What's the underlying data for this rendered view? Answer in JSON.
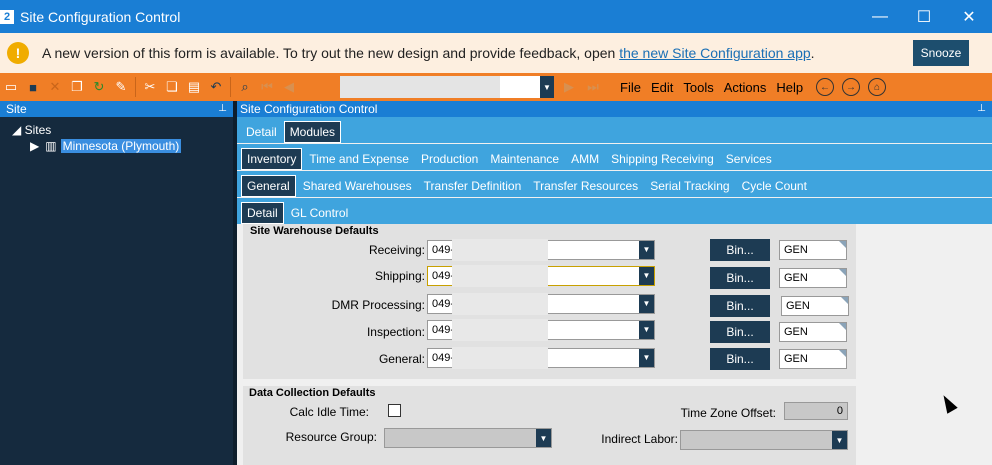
{
  "window": {
    "title": "Site Configuration Control",
    "app_glyph": "2",
    "minimize_glyph": "—",
    "maximize_glyph": "☐",
    "close_glyph": "✕"
  },
  "notice": {
    "icon_glyph": "!",
    "message": "A new version of this form is available. To try out the new design and provide feedback, open ",
    "link_text": "the new Site Configuration app",
    "message_end": ".",
    "snooze_label": "Snooze"
  },
  "toolbar": {
    "icons": [
      "new-icon",
      "save-icon",
      "delete-icon",
      "copy-icon",
      "refresh-icon",
      "eraser-icon",
      "cut-icon",
      "paste-icon",
      "clipboard-icon",
      "undo-icon",
      "find-icon",
      "first-record-icon",
      "prev-record-icon"
    ],
    "menu": [
      "File",
      "Edit",
      "Tools",
      "Actions",
      "Help"
    ]
  },
  "left_pane": {
    "title": "Site",
    "tree_root": "Sites",
    "tree_child": "Minnesota (Plymouth)"
  },
  "right_pane": {
    "title": "Site Configuration Control",
    "tabs_level1": [
      "Detail",
      "Modules"
    ],
    "tabs_level2": [
      "Inventory",
      "Time and Expense",
      "Production",
      "Maintenance",
      "AMM",
      "Shipping Receiving",
      "Services"
    ],
    "tabs_level3": [
      "General",
      "Shared Warehouses",
      "Transfer Definition",
      "Transfer Resources",
      "Serial Tracking",
      "Cycle Count"
    ],
    "tabs_level4": [
      "Detail",
      "GL Control"
    ]
  },
  "warehouse_defaults": {
    "title": "Site Warehouse Defaults",
    "rows": [
      {
        "label": "Receiving:",
        "value": "049-",
        "bin_label": "Bin...",
        "bin_value": "GEN"
      },
      {
        "label": "Shipping:",
        "value": "049-",
        "bin_label": "Bin...",
        "bin_value": "GEN"
      },
      {
        "label": "DMR Processing:",
        "value": "049-",
        "bin_label": "Bin...",
        "bin_value": "GEN"
      },
      {
        "label": "Inspection:",
        "value": "049-",
        "bin_label": "Bin...",
        "bin_value": "GEN"
      },
      {
        "label": "General:",
        "value": "049-",
        "bin_label": "Bin...",
        "bin_value": "GEN"
      }
    ]
  },
  "data_collection": {
    "title": "Data Collection Defaults",
    "calc_idle_label": "Calc Idle Time:",
    "time_zone_label": "Time Zone Offset:",
    "time_zone_value": "0",
    "resource_group_label": "Resource Group:",
    "indirect_labor_label": "Indirect Labor:"
  }
}
